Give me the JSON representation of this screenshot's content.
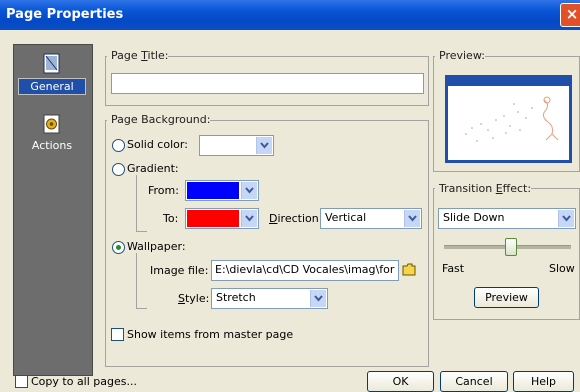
{
  "window": {
    "title": "Page Properties",
    "close_label": "×"
  },
  "nav": [
    {
      "label": "General",
      "icon": "page-icon"
    },
    {
      "label": "Actions",
      "icon": "actions-icon"
    }
  ],
  "page_title": {
    "label_pre": "Page ",
    "label_ul": "T",
    "label_post": "itle:",
    "value": ""
  },
  "background": {
    "header": "Page Background:",
    "solid_label": "Solid color:",
    "gradient_label": "Gradient:",
    "from_label": "From:",
    "from_color": "#0000ff",
    "to_label": "To:",
    "to_color": "#ff0000",
    "direction_label_ul": "D",
    "direction_label_post": "irection:",
    "direction_value": "Vertical",
    "wallpaper_label": "Wallpaper:",
    "image_file_label": "Image file:",
    "image_file_value": "E:\\dievla\\cd\\CD Vocales\\imag\\for",
    "style_label_ul": "S",
    "style_label_post": "tyle:",
    "style_value": "Stretch",
    "selected": "wallpaper"
  },
  "show_master": {
    "label": "Show items from master page",
    "checked": false
  },
  "preview": {
    "header": "Preview:"
  },
  "transition": {
    "header_pre": "Transition ",
    "header_ul": "E",
    "header_post": "ffect:",
    "value": "Slide Down",
    "fast_label": "Fast",
    "slow_label": "Slow",
    "speed": 0.52,
    "preview_button": "Preview"
  },
  "footer": {
    "copy_label": "Copy to all pages...",
    "ok": "OK",
    "cancel": "Cancel",
    "help": "Help"
  }
}
